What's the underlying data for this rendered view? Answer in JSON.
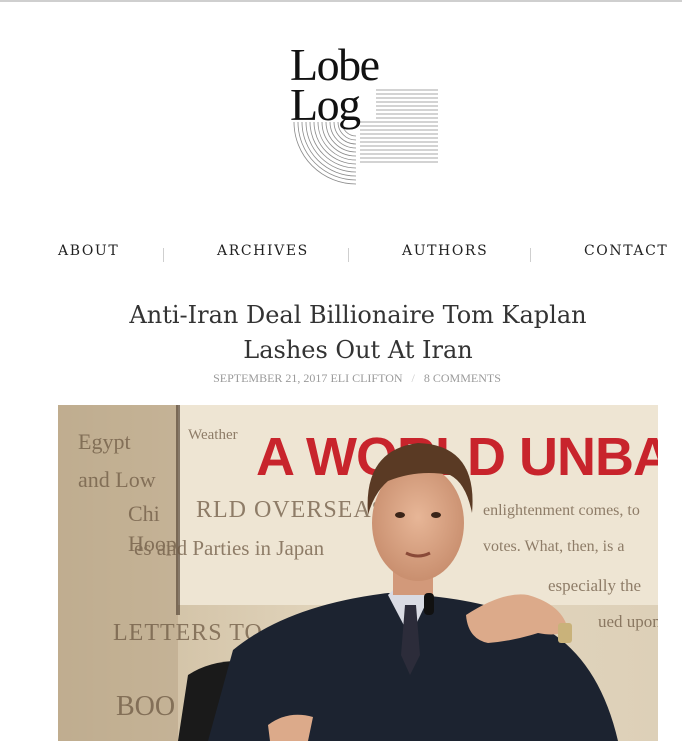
{
  "logo": {
    "line1": "Lobe",
    "line2": "Log"
  },
  "nav": {
    "items": [
      "ABOUT",
      "ARCHIVES",
      "AUTHORS",
      "CONTACT"
    ]
  },
  "article": {
    "title_line1": "Anti-Iran Deal Billionaire Tom Kaplan",
    "title_line2": "Lashes Out At Iran",
    "date": "SEPTEMBER 21, 2017",
    "author": "ELI CLIFTON",
    "comments": "8 COMMENTS"
  },
  "image": {
    "banner_text": "A WORLD UNBALANCE",
    "background_texts": [
      "Egypt",
      "Weather",
      "and Low",
      "Chi",
      "Hoop",
      "RLD OVERSEAS",
      "es and Parties in Japan",
      "LETTERS TO",
      "BOO",
      "enlightenment comes, to",
      "votes. What, then, is a",
      "especially the",
      "ued upon"
    ]
  },
  "colors": {
    "nav_text": "#222222",
    "title": "#333333",
    "meta": "#9a9a9a",
    "banner_red": "#c8242c"
  }
}
